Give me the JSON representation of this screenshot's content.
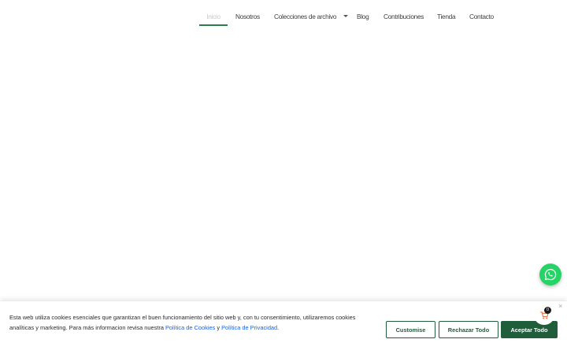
{
  "nav": {
    "items": [
      {
        "label": "Inicio"
      },
      {
        "label": "Nosotros"
      },
      {
        "label": "Colecciones de archivo"
      },
      {
        "label": "Blog"
      },
      {
        "label": "Contribuciones"
      },
      {
        "label": "Tienda"
      },
      {
        "label": "Contacto"
      }
    ]
  },
  "whatsapp": {
    "icon": "whatsapp-icon"
  },
  "cookie": {
    "text_before": "Esta web utiliza cookies esenciales que garantizan el buen funcionamiento del sitio web y, con tu consentimiento, utilizaremos cookies analíticas y marketing. Para más informacion revisa nuestra ",
    "cookies_link": "Política de Cookies",
    "and": " y ",
    "privacy_link": "Política de Privacidad",
    "period": ".",
    "customise_label": "Customise",
    "reject_label": "Rechazar Todo",
    "accept_label": "Aceptar Todo",
    "close_glyph": "×"
  },
  "cart": {
    "count": "0",
    "icon": "cart-icon"
  },
  "colors": {
    "brand": "#1f5d3b",
    "link": "#1863dc",
    "whatsapp": "#25d366"
  }
}
